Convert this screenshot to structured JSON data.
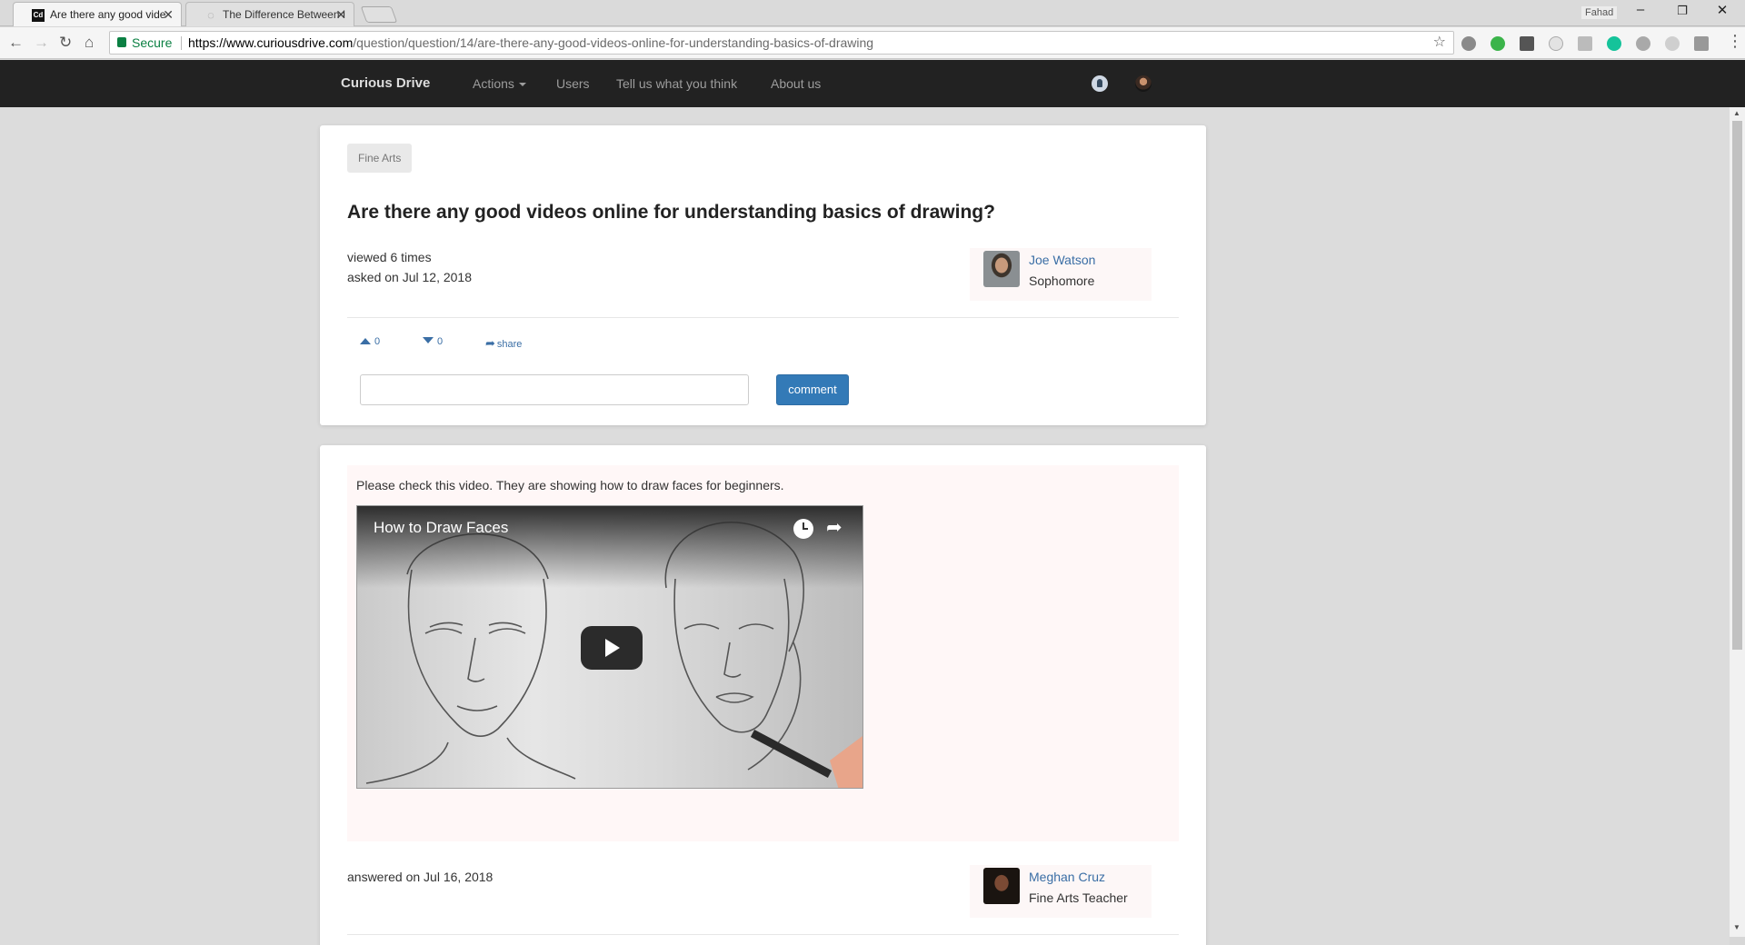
{
  "browser": {
    "tabs": [
      {
        "title": "Are there any good vide",
        "favicon": "Cd",
        "active": true
      },
      {
        "title": "The Difference Between I",
        "favicon": "◌",
        "active": false
      }
    ],
    "window_user": "Fahad",
    "secure_label": "Secure",
    "url_scheme_host": "https://www.curiousdrive.com",
    "url_path": "/question/question/14/are-there-any-good-videos-online-for-understanding-basics-of-drawing"
  },
  "navbar": {
    "brand": "Curious Drive",
    "links": [
      "Actions",
      "Users",
      "Tell us what you think",
      "About us"
    ]
  },
  "question": {
    "category": "Fine Arts",
    "title": "Are there any good videos online for understanding basics of drawing?",
    "views": "viewed 6 times",
    "asked": "asked on Jul 12, 2018",
    "author": {
      "name": "Joe Watson",
      "role": "Sophomore"
    },
    "upvotes": "0",
    "downvotes": "0",
    "share_label": "share",
    "comment_label": "comment"
  },
  "answer": {
    "text": "Please check this video. They are showing how to draw faces for beginners.",
    "video_title": "How to Draw Faces",
    "answered": "answered on Jul 16, 2018",
    "author": {
      "name": "Meghan Cruz",
      "role": "Fine Arts Teacher"
    }
  },
  "colors": {
    "navbar_bg": "#222222",
    "link": "#3a6ea5",
    "primary_button": "#337ab7",
    "secure_green": "#0b8043"
  }
}
